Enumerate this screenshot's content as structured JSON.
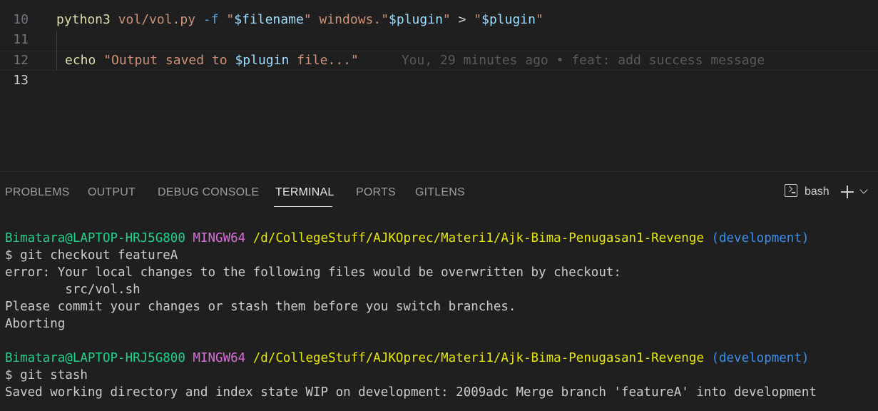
{
  "editor": {
    "lines": [
      {
        "number": "10"
      },
      {
        "number": "11",
        "tokens": [
          "python3",
          " vol/vol.py",
          " -f",
          " \"",
          "$filename",
          "\"",
          " windows.\"",
          "$plugin",
          "\"",
          " > ",
          "\"",
          "$plugin",
          "\""
        ]
      },
      {
        "number": "12"
      },
      {
        "number": "13",
        "tokens": [
          "echo",
          " \"Output saved to ",
          "$plugin",
          " file...\""
        ],
        "blame": "You, 29 minutes ago • feat: add success message"
      }
    ]
  },
  "panel": {
    "tabs": [
      "PROBLEMS",
      "OUTPUT",
      "DEBUG CONSOLE",
      "TERMINAL",
      "PORTS",
      "GITLENS"
    ],
    "active_tab": "TERMINAL",
    "shell_label": "bash",
    "icons": {
      "terminal": "terminal-icon",
      "add": "plus-icon",
      "dropdown": "chevron-down-icon"
    }
  },
  "terminal": {
    "prompt1": {
      "user": "Bimatara@LAPTOP-HRJ5G800",
      "env": "MINGW64",
      "path": "/d/CollegeStuff/AJKOprec/Materi1/Ajk-Bima-Penugasan1-Revenge",
      "branch": "(development)"
    },
    "cmd1": "$ git checkout featureA",
    "out1": [
      "error: Your local changes to the following files would be overwritten by checkout:",
      "        src/vol.sh",
      "Please commit your changes or stash them before you switch branches.",
      "Aborting"
    ],
    "prompt2": {
      "user": "Bimatara@LAPTOP-HRJ5G800",
      "env": "MINGW64",
      "path": "/d/CollegeStuff/AJKOprec/Materi1/Ajk-Bima-Penugasan1-Revenge",
      "branch": "(development)"
    },
    "cmd2": "$ git stash",
    "out2": "Saved working directory and index state WIP on development: 2009adc Merge branch 'featureA' into development"
  },
  "colors": {
    "background": "#1f1f1f",
    "user": "#23d18b",
    "mingw": "#d670d6",
    "path": "#e5e510",
    "branch": "#3b8eea"
  }
}
